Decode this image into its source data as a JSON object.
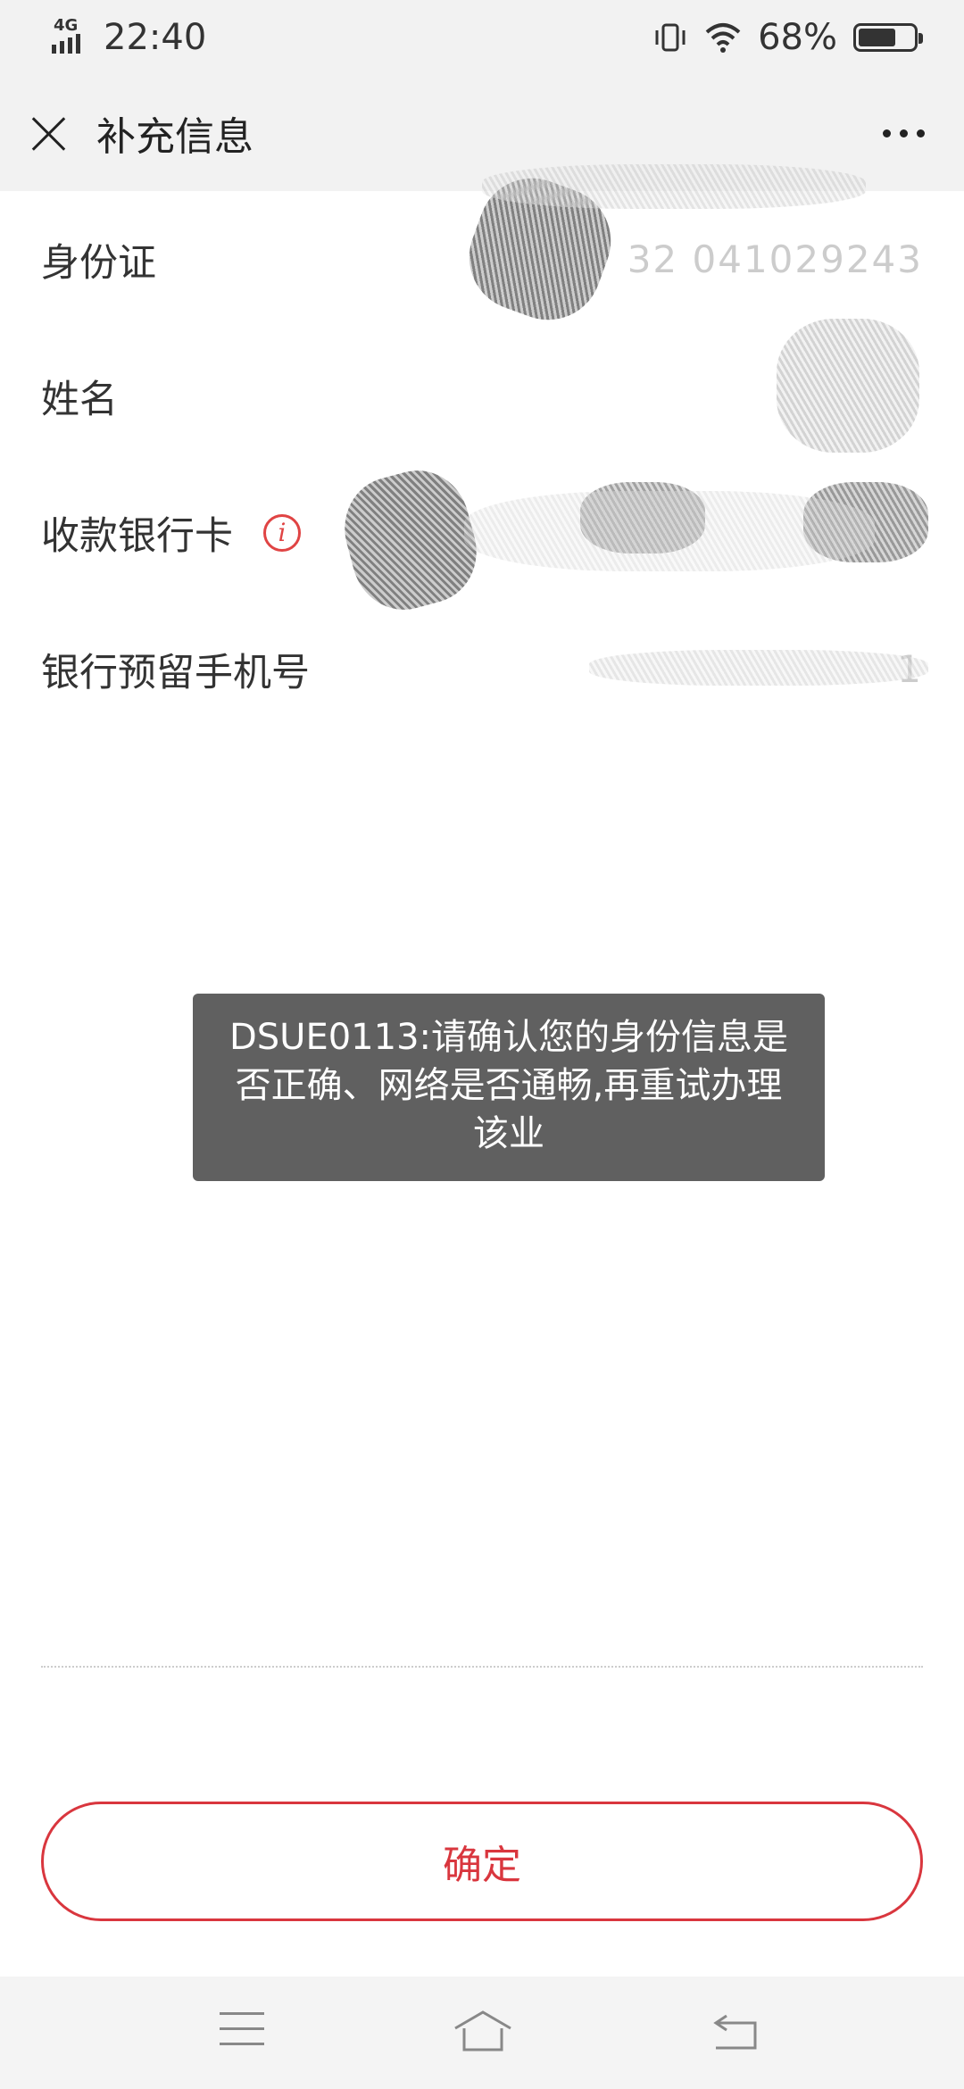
{
  "status_bar": {
    "network": "4G",
    "time": "22:40",
    "battery": "68%",
    "battery_level": 0.68
  },
  "header": {
    "title": "补充信息"
  },
  "form": {
    "rows": [
      {
        "label": "身份证",
        "value": "32 041029243"
      },
      {
        "label": "姓名"
      },
      {
        "label": "收款银行卡"
      },
      {
        "label": "银行预留手机号",
        "value": "1"
      }
    ]
  },
  "toast": {
    "message": "DSUE0113:请确认您的身份信息是否正确、网络是否通畅,再重试办理该业"
  },
  "actions": {
    "confirm_label": "确定"
  },
  "colors": {
    "accent": "#d9363e",
    "toast_bg": "#606060",
    "bar_bg": "#f2f2f2"
  },
  "icons": {
    "close": "close-icon",
    "more": "more-icon",
    "info": "info-icon",
    "menu": "menu-icon",
    "home": "home-icon",
    "back": "back-icon"
  }
}
